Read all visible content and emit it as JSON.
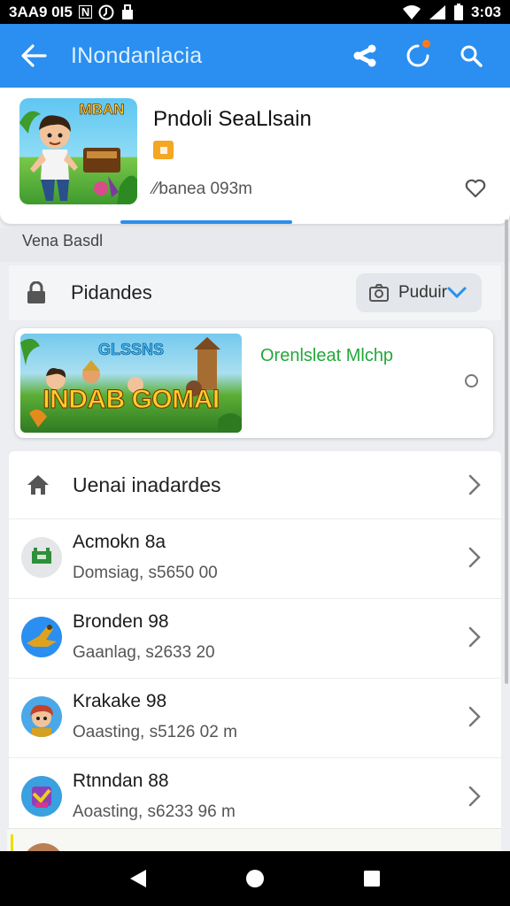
{
  "status_bar": {
    "left_text": "3AA9 0I5",
    "mini_icon": "N",
    "time": "3:03"
  },
  "app_bar": {
    "title": "INondanlacia",
    "icons": [
      "back-arrow-icon",
      "share-icon",
      "notification-icon",
      "search-icon"
    ]
  },
  "game": {
    "name": "Pndoli SeaLlsain",
    "subtitle": "⁄⁄banea 093m",
    "thumb_text": "MBAN",
    "badge_color": "#f5a623"
  },
  "section": {
    "label": "Vena Basdl"
  },
  "filter": {
    "label": "Pidandes",
    "select_value": "Puduir"
  },
  "promo": {
    "banner_top": "GLSSNS",
    "banner_main": "INDAB GOMAI",
    "title": "Orenlsleat Mlchp"
  },
  "list": {
    "header": "Uenai inadardes",
    "items": [
      {
        "name": "Acmokn 8a",
        "sub": "Domsiag, s5650 00",
        "avatar": "game-avatar-green"
      },
      {
        "name": "Bronden 98",
        "sub": "Gaanlag, s2633 20",
        "avatar": "game-avatar-blue"
      },
      {
        "name": "Krakake 98",
        "sub": "Oaasting, s5126 02 m",
        "avatar": "game-avatar-hero"
      },
      {
        "name": "Rtnndan 88",
        "sub": "Aoasting, s6233 96 m",
        "avatar": "game-avatar-purple"
      }
    ]
  },
  "colors": {
    "primary": "#2a8ff0",
    "accent_green": "#24a83a",
    "badge_orange": "#f5a623"
  }
}
